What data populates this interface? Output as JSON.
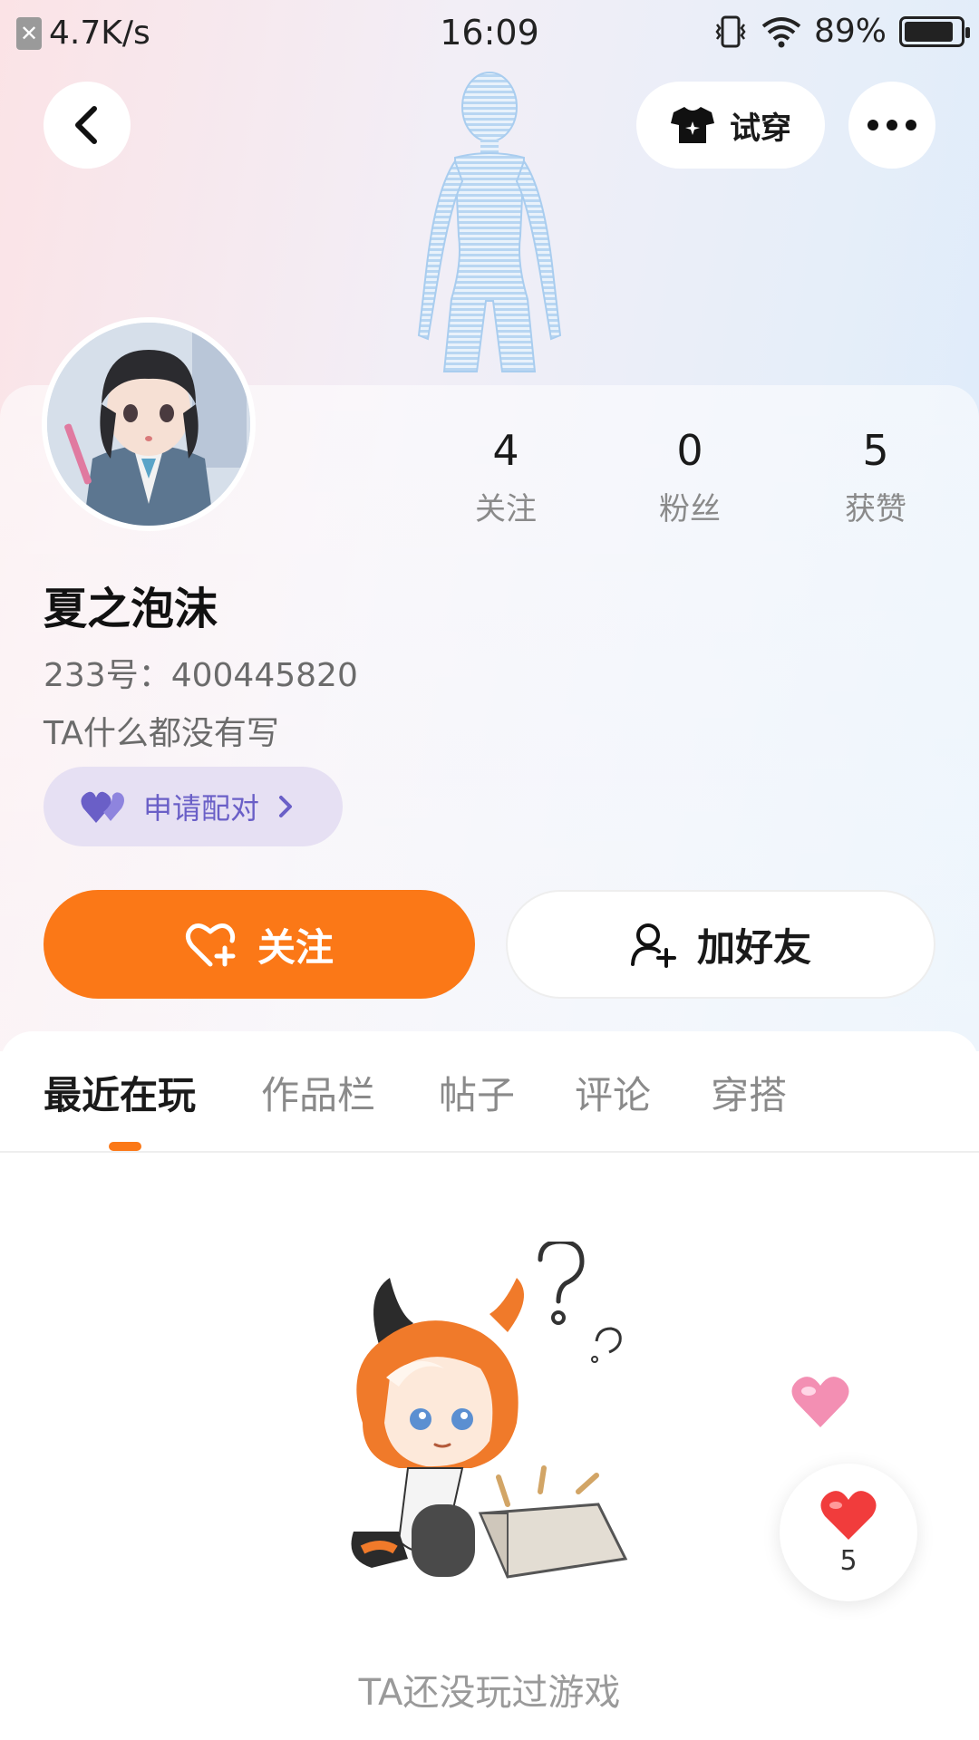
{
  "status_bar": {
    "net_speed": "4.7K/s",
    "time": "16:09",
    "battery_percent": "89%",
    "battery_level": 0.89
  },
  "header": {
    "tryon_label": "试穿"
  },
  "profile": {
    "stats": [
      {
        "value": "4",
        "label": "关注"
      },
      {
        "value": "0",
        "label": "粉丝"
      },
      {
        "value": "5",
        "label": "获赞"
      }
    ],
    "username": "夏之泡沫",
    "uid": "233号：400445820",
    "bio": "TA什么都没有写",
    "pair_label": "申请配对"
  },
  "actions": {
    "follow_label": "关注",
    "add_friend_label": "加好友"
  },
  "tabs": [
    {
      "label": "最近在玩",
      "active": true
    },
    {
      "label": "作品栏",
      "active": false
    },
    {
      "label": "帖子",
      "active": false
    },
    {
      "label": "评论",
      "active": false
    },
    {
      "label": "穿搭",
      "active": false
    }
  ],
  "empty_state": {
    "message": "TA还没玩过游戏"
  },
  "like_float": {
    "count": "5"
  },
  "colors": {
    "accent": "#fb7817",
    "pair_bg": "#e6e0f3",
    "pair_text": "#6a5fc7"
  }
}
